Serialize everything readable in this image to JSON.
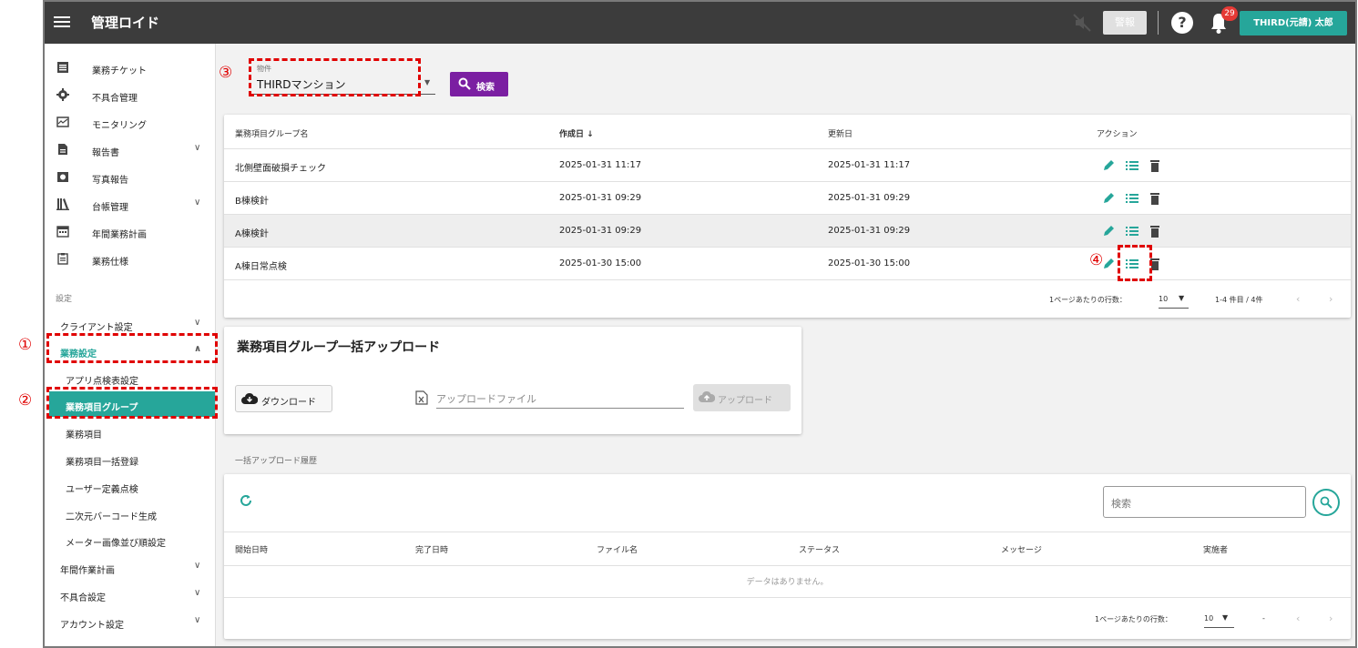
{
  "app": {
    "title": "管理ロイド"
  },
  "topbar": {
    "gray_button": "警報",
    "notification_count": "29",
    "user": "THIRD(元請) 太郎"
  },
  "sidebar": {
    "nav": [
      {
        "label": "業務チケット",
        "icon": "ticket-icon",
        "chevron": false
      },
      {
        "label": "不具合管理",
        "icon": "gear-icon",
        "chevron": false
      },
      {
        "label": "モニタリング",
        "icon": "monitor-icon",
        "chevron": false
      },
      {
        "label": "報告書",
        "icon": "document-icon",
        "chevron": true
      },
      {
        "label": "写真報告",
        "icon": "camera-icon",
        "chevron": false
      },
      {
        "label": "台帳管理",
        "icon": "ledger-icon",
        "chevron": true
      },
      {
        "label": "年間業務計画",
        "icon": "calendar-icon",
        "chevron": false
      },
      {
        "label": "業務仕様",
        "icon": "clipboard-icon",
        "chevron": false
      }
    ],
    "section_label": "設定",
    "client_settings": "クライアント設定",
    "business_settings": "業務設定",
    "sub_items": [
      "アプリ点検表設定",
      "業務項目グループ",
      "業務項目",
      "業務項目一括登録",
      "ユーザー定義点検",
      "二次元バーコード生成",
      "メーター画像並び順設定"
    ],
    "bottom_items": [
      "年間作業計画",
      "不具合設定",
      "アカウント設定"
    ]
  },
  "property": {
    "label": "物件",
    "value": "THIRDマンション",
    "search_button": "検索"
  },
  "group_table": {
    "headers": [
      "業務項目グループ名",
      "作成日 ↓",
      "更新日",
      "アクション"
    ],
    "rows": [
      {
        "name": "北側壁面破損チェック",
        "created": "2025-01-31 11:17",
        "updated": "2025-01-31 11:17"
      },
      {
        "name": "B棟検針",
        "created": "2025-01-31 09:29",
        "updated": "2025-01-31 09:29"
      },
      {
        "name": "A棟検針",
        "created": "2025-01-31 09:29",
        "updated": "2025-01-31 09:29"
      },
      {
        "name": "A棟日常点検",
        "created": "2025-01-30 15:00",
        "updated": "2025-01-30 15:00"
      }
    ],
    "rows_per_page_label": "1ページあたりの行数：",
    "rows_per_page": "10",
    "range": "1-4 件目 / 4件"
  },
  "bulk_upload": {
    "title": "業務項目グループ一括アップロード",
    "download_button": "ダウンロード",
    "file_placeholder": "アップロードファイル",
    "upload_button": "アップロード"
  },
  "history": {
    "label": "一括アップロード履歴",
    "search_placeholder": "検索",
    "headers": [
      "開始日時",
      "完了日時",
      "ファイル名",
      "ステータス",
      "メッセージ",
      "実施者"
    ],
    "empty_text": "データはありません。",
    "rows_per_page_label": "1ページあたりの行数：",
    "rows_per_page": "10",
    "range": "-"
  },
  "annotations": [
    "①",
    "②",
    "③",
    "④"
  ],
  "colors": {
    "accent": "#26a69a",
    "search_button": "#7b1fa2",
    "topbar": "#3c3c3c",
    "annotation": "#e00000"
  }
}
